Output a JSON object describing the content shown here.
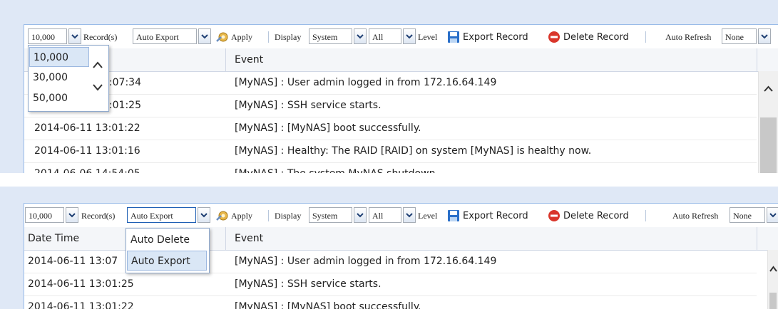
{
  "toolbar": {
    "count_value": "10,000",
    "records_label": "Record(s)",
    "action_value": "Auto Export",
    "apply_label": "Apply",
    "display_label": "Display",
    "source_value": "System",
    "level_value": "All",
    "level_label": "Level",
    "export_label": "Export Record",
    "delete_label": "Delete Record",
    "auto_refresh_label": "Auto Refresh",
    "refresh_value": "None"
  },
  "grid": {
    "col_datetime": "Date Time",
    "col_event": "Event"
  },
  "panel1": {
    "rows": [
      {
        "time": "3:07:34",
        "event": "[MyNAS] : User admin logged in from 172.16.64.149"
      },
      {
        "time": "3:01:25",
        "event": "[MyNAS] : SSH service starts."
      },
      {
        "time": "2014-06-11 13:01:22",
        "event": "[MyNAS] : [MyNAS] boot successfully."
      },
      {
        "time": "2014-06-11 13:01:16",
        "event": "[MyNAS] : Healthy: The RAID [RAID] on system [MyNAS] is healthy now."
      },
      {
        "time": "2014-06-06 14:54:05",
        "event": "[MyNAS] : The system MyNAS shutdown."
      }
    ],
    "count_dropdown": [
      "10,000",
      "30,000",
      "50,000"
    ]
  },
  "panel2": {
    "rows": [
      {
        "time": "2014-06-11 13:07",
        "event": "[MyNAS] : User admin logged in from 172.16.64.149"
      },
      {
        "time": "2014-06-11 13:01:25",
        "event": "[MyNAS] : SSH service starts."
      },
      {
        "time": "2014-06-11 13:01:22",
        "event": "[MyNAS] : [MyNAS] boot successfully."
      }
    ],
    "action_dropdown": [
      "Auto Delete",
      "Auto Export"
    ]
  },
  "colors": {
    "background": "#dfe8f6",
    "border": "#99bbe8",
    "highlight": "#dae7f6",
    "delete_red": "#d9362b",
    "export_blue": "#2a6fc9"
  },
  "icons": [
    "chevron-down-icon",
    "gear-apply-icon",
    "floppy-export-icon",
    "delete-circle-icon",
    "chevron-up-icon"
  ]
}
